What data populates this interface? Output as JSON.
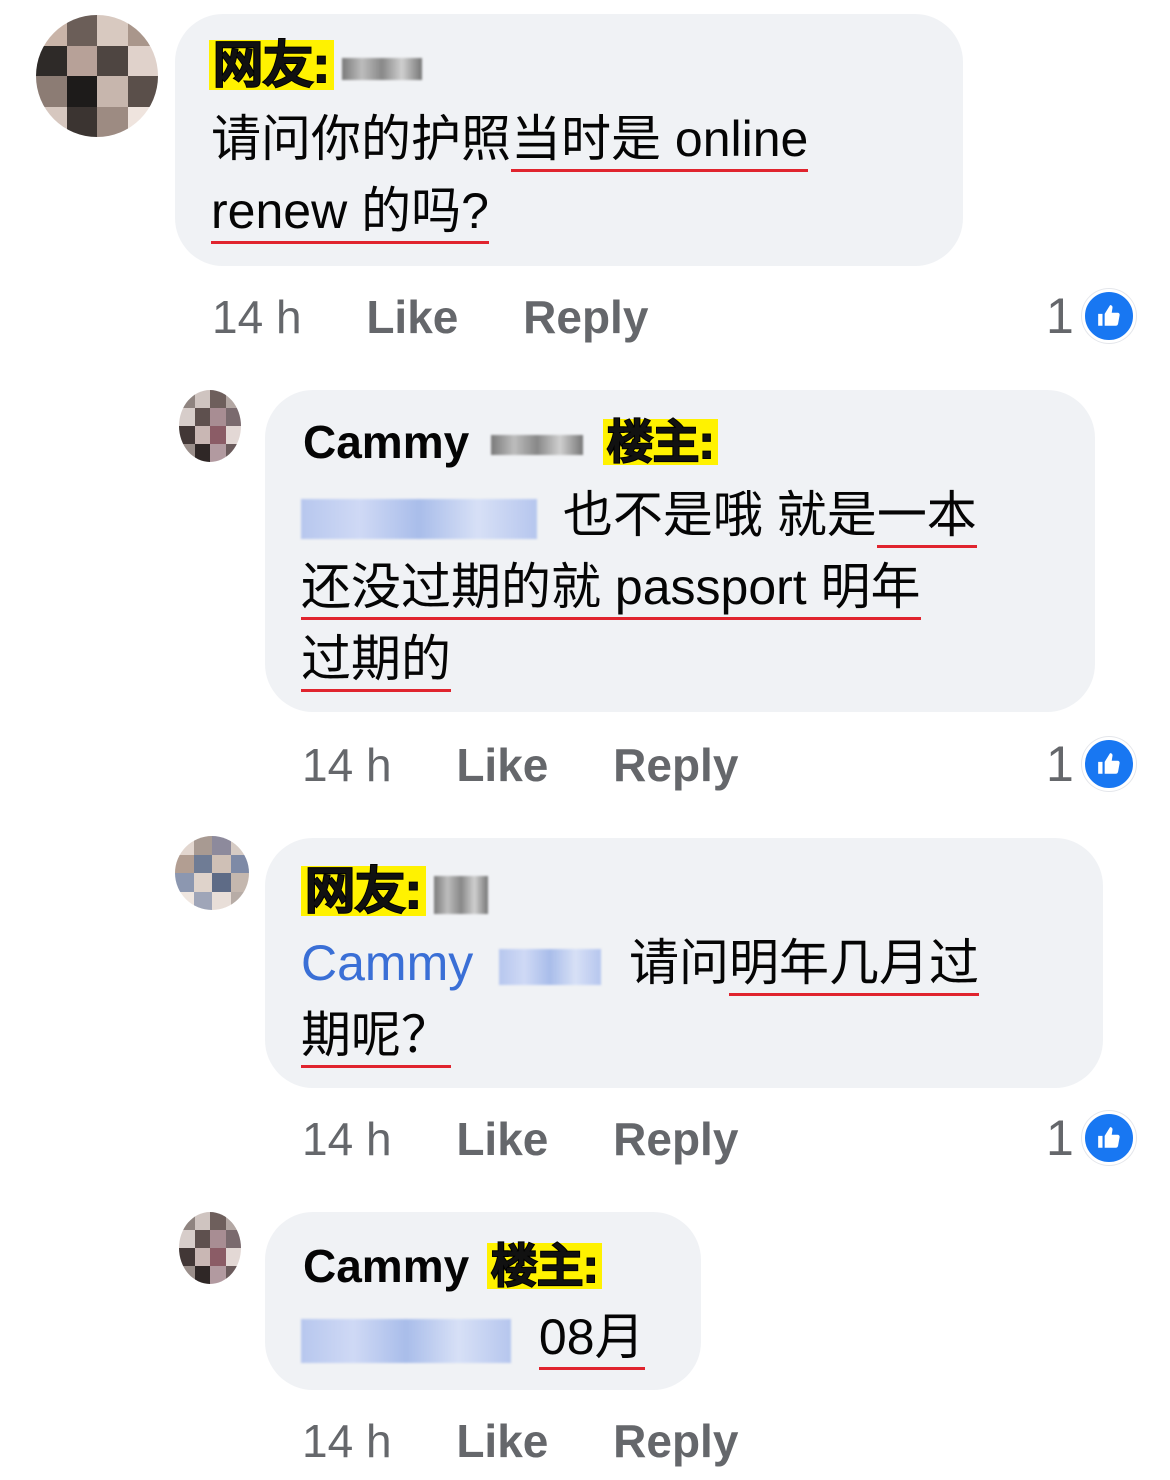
{
  "comments": [
    {
      "tag": "网友:",
      "name": "",
      "text_line1_a": "请问你的护照",
      "text_line1_b": "当时是 online",
      "text_line2": "renew 的吗?",
      "time": "14 h",
      "like": "Like",
      "reply": "Reply",
      "reactions": "1"
    },
    {
      "name": "Cammy",
      "tag": "楼主:",
      "text_line1": "也不是哦 就是",
      "text_line1_ul": "一本",
      "text_line2": "还没过期的就 passport 明年",
      "text_line3": "过期的",
      "time": "14 h",
      "like": "Like",
      "reply": "Reply",
      "reactions": "1"
    },
    {
      "tag": "网友:",
      "mention": "Cammy",
      "text_line1_a": "请问",
      "text_line1_b": "明年几月过",
      "text_line2": "期呢？",
      "time": "14 h",
      "like": "Like",
      "reply": "Reply",
      "reactions": "1"
    },
    {
      "name": "Cammy",
      "tag": "楼主:",
      "text_line1": "08月",
      "time": "14 h",
      "like": "Like",
      "reply": "Reply"
    }
  ],
  "colors": {
    "bubble": "#f0f2f5",
    "meta": "#65676b",
    "underline": "#e0242e",
    "like_blue": "#1877f2",
    "tag_yellow": "#fff200",
    "mention": "#3a6fd6"
  },
  "icons": [
    "thumbs-up-icon"
  ]
}
